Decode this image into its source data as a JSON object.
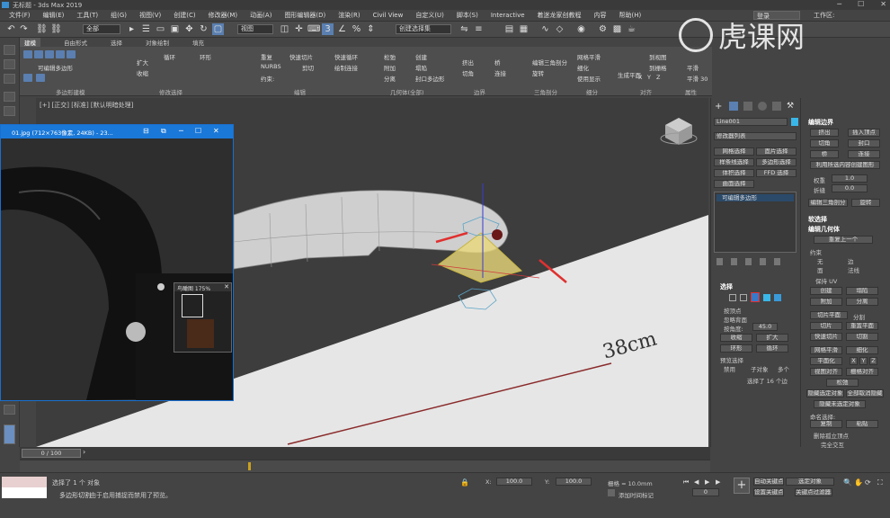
{
  "titlebar": {
    "title": "无标题 - 3ds Max 2019"
  },
  "menu": {
    "items": [
      "文件(F)",
      "编辑(E)",
      "工具(T)",
      "组(G)",
      "视图(V)",
      "创建(C)",
      "修改器(M)",
      "动画(A)",
      "图形编辑器(D)",
      "渲染(R)",
      "Civil View",
      "自定义(U)",
      "脚本(S)",
      "Interactive",
      "着迷龙家创教程",
      "内容",
      "帮助(H)"
    ],
    "sign_in": "登录",
    "workspace": "工作区:"
  },
  "toolbar": {
    "filter": "全部",
    "view": "视图",
    "selset": "创建选择集"
  },
  "ribbon": {
    "tabs": [
      "建模",
      "自由形式",
      "选择",
      "对象绘制",
      "填充"
    ],
    "active_tab": "建模",
    "groups": [
      "多边形建模",
      "修改选择",
      "编辑",
      "几何体(全部)",
      "边界",
      "三角剖分",
      "细分",
      "对齐",
      "属性"
    ],
    "labels": [
      "可编辑多边形",
      "扩大",
      "收缩",
      "循环",
      "环形",
      "重复",
      "快速切片",
      "快速循环",
      "NURBS",
      "剪切",
      "绘制连接",
      "约束:",
      "松弛",
      "创建",
      "附加",
      "塌陷",
      "分离",
      "封口多边形",
      "挤出",
      "桥",
      "切角",
      "连接",
      "编辑三角剖分",
      "旋转",
      "网格平滑",
      "细化",
      "使用显示",
      "生成平面",
      "X",
      "Y",
      "Z",
      "到视图",
      "到栅格",
      "平滑",
      "平滑 30"
    ]
  },
  "viewport": {
    "label": "[+] [正交] [标准] [默认明暗处理]",
    "annotation": "38cm"
  },
  "image_window": {
    "title": "01.jpg (712×763像素, 24KB) - 23...",
    "nav_title": "鸟瞰图 175%"
  },
  "command_panel": {
    "object_name": "Line001",
    "modifier_list": "修改器列表",
    "buttons": [
      "网格选择",
      "面片选择",
      "样条线选择",
      "多边形选择",
      "体积选择",
      "FFD 选择",
      "曲面选择"
    ],
    "stack_item": "可编辑多边形",
    "selection_header": "选择",
    "by_vertex": "按顶点",
    "ignore_back": "忽略背面",
    "by_angle": "按角度:",
    "angle_value": "45.0",
    "shrink": "收缩",
    "grow": "扩大",
    "ring": "环形",
    "loop": "循环",
    "preview_header": "预览选择",
    "preview_opts": [
      "禁用",
      "子对象",
      "多个"
    ],
    "status": "选择了 16 个边"
  },
  "right_panel": {
    "edit_border_header": "编辑边界",
    "btns1": [
      "挤出",
      "插入顶点",
      "切角",
      "封口",
      "桥",
      "连接"
    ],
    "create_shape": "利用所选内容创建图形",
    "weight_label": "权重",
    "weight_value": "1.0",
    "crease_label": "折缝",
    "crease_value": "0.0",
    "edit_tri": "编辑三角剖分",
    "rotate": "旋转",
    "soft_sel": "软选择",
    "edit_geom": "编辑几何体",
    "repeat_last": "重复上一个",
    "constraint": "约束",
    "constraint_opts": [
      "无",
      "边",
      "面",
      "法线"
    ],
    "keep_uv": "保持 UV",
    "create": "创建",
    "collapse": "塌陷",
    "attach": "附加",
    "detach": "分离",
    "slice_plane": "切片平面",
    "split": "分割",
    "slice": "切片",
    "reset_plane": "重置平面",
    "quickslice": "快速切片",
    "cut": "切割",
    "meshsmooth": "网格平滑",
    "tessellate": "细化",
    "make_planar": "平面化",
    "xyz": [
      "X",
      "Y",
      "Z"
    ],
    "view_align": "视图对齐",
    "grid_align": "栅格对齐",
    "relax": "松弛",
    "hide_sel": "隐藏选定对象",
    "unhide_all": "全部取消隐藏",
    "hide_unsel": "隐藏未选定对象",
    "named_sel": "命名选择:",
    "copy": "复制",
    "paste": "粘贴",
    "delete_iso": "删除孤立顶点",
    "full_interact": "完全交互"
  },
  "timeline": {
    "frame": "0 / 100"
  },
  "status": {
    "selected": "选择了 1 个 对象",
    "message": "由于启用捕捉而禁用了预览。",
    "script_hint": "多边形切割",
    "x_label": "X:",
    "x_value": "100.0",
    "y_label": "Y:",
    "y_value": "100.0",
    "grid": "栅格 = 10.0mm",
    "autokey": "自动关键点",
    "selobj": "选定对象",
    "setkey": "设置关键点",
    "keyfilter": "关键点过滤器...",
    "addtime": "添加时间标记",
    "frame_value": "0"
  },
  "watermark": {
    "text": "虎课网"
  }
}
